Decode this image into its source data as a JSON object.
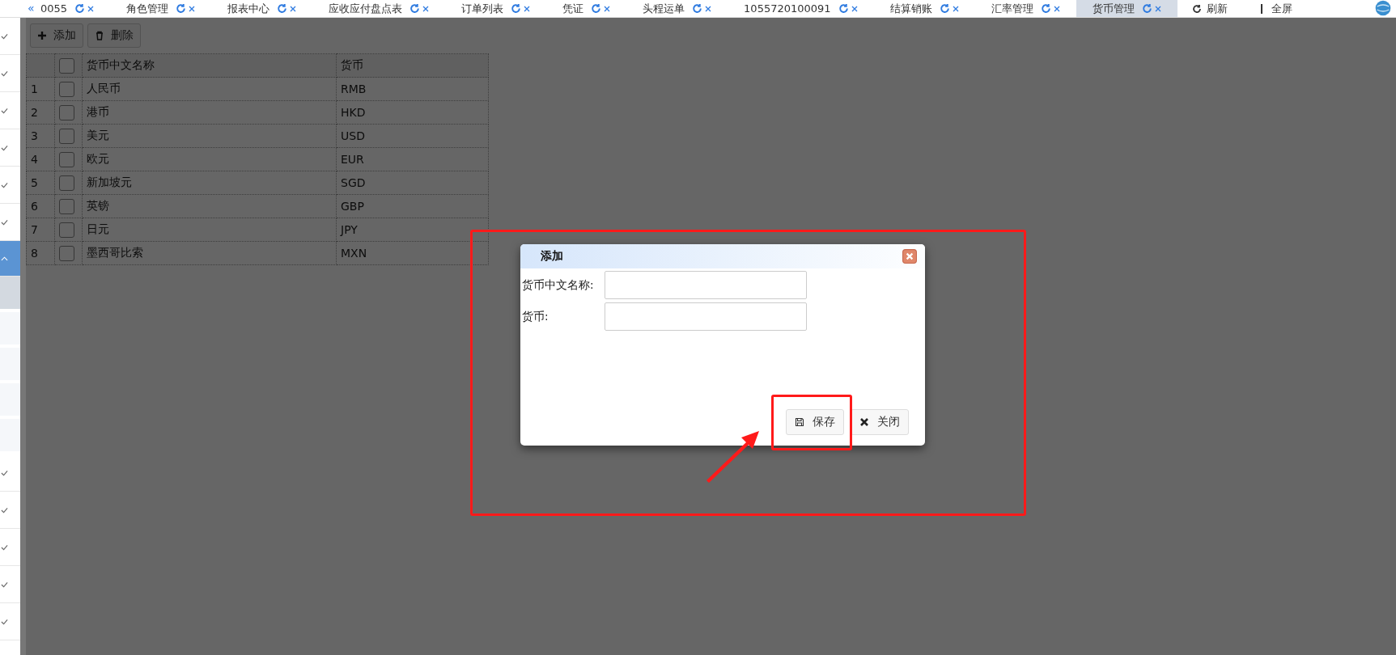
{
  "tab_scroll": "«",
  "tabs": [
    {
      "label": "0055",
      "selected": false
    },
    {
      "label": "角色管理",
      "selected": false
    },
    {
      "label": "报表中心",
      "selected": false
    },
    {
      "label": "应收应付盘点表",
      "selected": false
    },
    {
      "label": "订单列表",
      "selected": false
    },
    {
      "label": "凭证",
      "selected": false
    },
    {
      "label": "头程运单",
      "selected": false
    },
    {
      "label": "1055720100091",
      "selected": false
    },
    {
      "label": "结算销账",
      "selected": false
    },
    {
      "label": "汇率管理",
      "selected": false
    },
    {
      "label": "货币管理",
      "selected": true
    }
  ],
  "top_actions": [
    {
      "kind": "refresh",
      "label": "刷新"
    },
    {
      "kind": "fullscreen",
      "label": "全屏"
    }
  ],
  "sidebar": {
    "items": [
      {
        "kind": "check"
      },
      {
        "kind": "check"
      },
      {
        "kind": "check"
      },
      {
        "kind": "check"
      },
      {
        "kind": "check"
      },
      {
        "kind": "check"
      },
      {
        "kind": "open"
      },
      {
        "kind": "sub",
        "selected": true
      },
      {
        "kind": "sub",
        "selected": false
      },
      {
        "kind": "sub",
        "selected": false
      },
      {
        "kind": "sub",
        "selected": false
      },
      {
        "kind": "sub",
        "selected": false
      },
      {
        "kind": "check"
      },
      {
        "kind": "check"
      },
      {
        "kind": "check"
      },
      {
        "kind": "check"
      },
      {
        "kind": "check"
      }
    ]
  },
  "toolbar": [
    {
      "kind": "add",
      "label": "添加"
    },
    {
      "kind": "delete",
      "label": "删除"
    }
  ],
  "table": {
    "all_checked": false,
    "columns": [
      "货币中文名称",
      "货币"
    ],
    "rows": [
      {
        "index": "1",
        "name": "人民币",
        "code": "RMB",
        "checked": false
      },
      {
        "index": "2",
        "name": "港币",
        "code": "HKD",
        "checked": false
      },
      {
        "index": "3",
        "name": "美元",
        "code": "USD",
        "checked": false
      },
      {
        "index": "4",
        "name": "欧元",
        "code": "EUR",
        "checked": false
      },
      {
        "index": "5",
        "name": "新加坡元",
        "code": "SGD",
        "checked": false
      },
      {
        "index": "6",
        "name": "英镑",
        "code": "GBP",
        "checked": false
      },
      {
        "index": "7",
        "name": "日元",
        "code": "JPY",
        "checked": false
      },
      {
        "index": "8",
        "name": "墨西哥比索",
        "code": "MXN",
        "checked": false
      }
    ]
  },
  "dialog": {
    "title": "添加",
    "fields": [
      {
        "label": "货币中文名称:"
      },
      {
        "label": "货币:"
      }
    ],
    "buttons": [
      {
        "kind": "save",
        "label": "保存"
      },
      {
        "kind": "close",
        "label": "关闭"
      }
    ]
  }
}
